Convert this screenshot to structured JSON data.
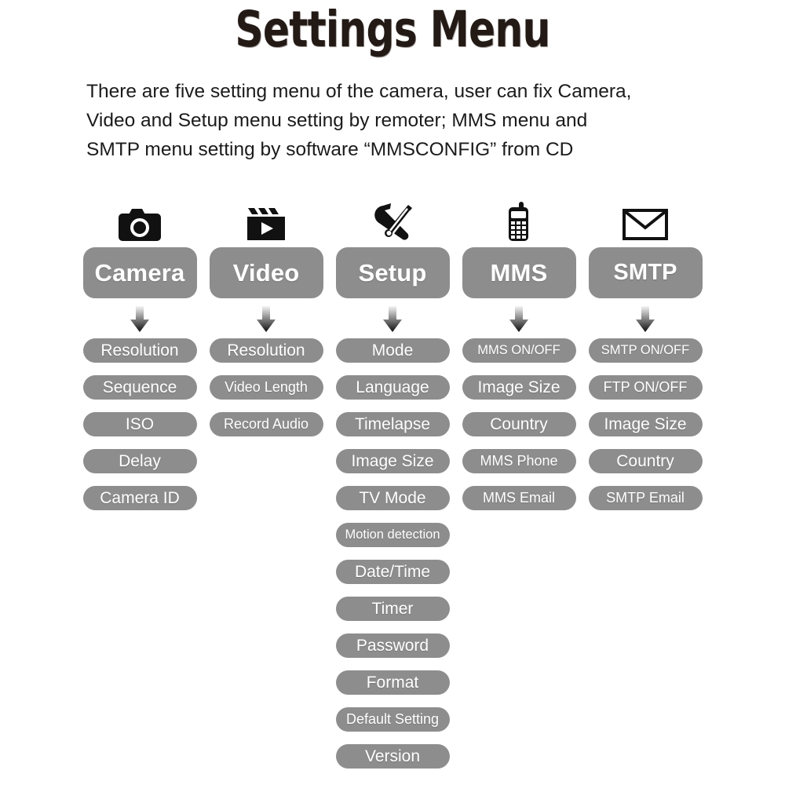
{
  "page": {
    "title": "Settings Menu",
    "intro_lines": [
      "There are five setting menu of the camera, user can fix Camera,",
      "Video and Setup menu setting by remoter; MMS menu and",
      "SMTP menu setting by software “MMSCONFIG” from CD"
    ]
  },
  "colors": {
    "pill_gray": "#8d8d8d",
    "pill_text": "#ffffff",
    "title_text": "#231a16",
    "body_text": "#1b1b1b",
    "background": "#ffffff",
    "arrow_top": "#f2f2f2",
    "arrow_bottom": "#0d0d0d"
  },
  "columns": [
    {
      "id": "camera",
      "label": "Camera",
      "icon": "camera-icon",
      "arrow": "down-arrow-icon",
      "items": [
        "Resolution",
        "Sequence",
        "ISO",
        "Delay",
        "Camera ID"
      ]
    },
    {
      "id": "video",
      "label": "Video",
      "icon": "clapperboard-icon",
      "arrow": "down-arrow-icon",
      "items": [
        "Resolution",
        "Video Length",
        "Record Audio"
      ]
    },
    {
      "id": "setup",
      "label": "Setup",
      "icon": "wrench-screwdriver-icon",
      "arrow": "down-arrow-icon",
      "items": [
        "Mode",
        "Language",
        "Timelapse",
        "Image Size",
        "TV Mode",
        "Motion detection",
        "Date/Time",
        "Timer",
        "Password",
        "Format",
        "Default Setting",
        "Version"
      ]
    },
    {
      "id": "mms",
      "label": "MMS",
      "icon": "mobile-phone-icon",
      "arrow": "down-arrow-icon",
      "items": [
        "MMS ON/OFF",
        "Image Size",
        "Country",
        "MMS Phone",
        "MMS Email"
      ]
    },
    {
      "id": "smtp",
      "label": "SMTP",
      "icon": "envelope-icon",
      "arrow": "down-arrow-icon",
      "items": [
        "SMTP ON/OFF",
        "FTP ON/OFF",
        "Image Size",
        "Country",
        "SMTP Email"
      ]
    }
  ]
}
